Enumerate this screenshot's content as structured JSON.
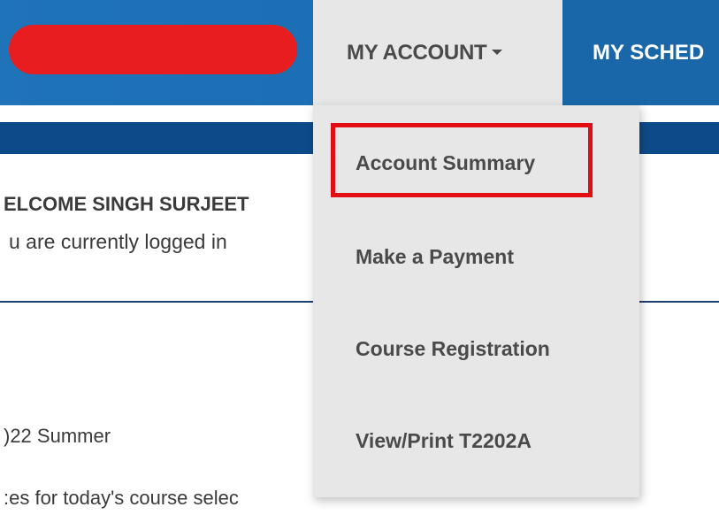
{
  "header": {
    "account_menu_label": "MY ACCOUNT",
    "schedule_label": "MY SCHED"
  },
  "dropdown": {
    "items": [
      {
        "label": "Account Summary",
        "highlighted": true
      },
      {
        "label": "Make a Payment"
      },
      {
        "label": "Course Registration"
      },
      {
        "label": "View/Print T2202A"
      }
    ]
  },
  "main": {
    "welcome": "ELCOME SINGH SURJEET",
    "logged_in": "u are currently logged in",
    "term": ")22 Summer",
    "fees_note": ":es for today's course selec"
  },
  "colors": {
    "header_blue": "#1f73b8",
    "stripe_navy": "#0d4a8a",
    "menu_bg": "#e7e7e7",
    "redaction": "#e81d1f",
    "highlight": "#e30d14"
  }
}
